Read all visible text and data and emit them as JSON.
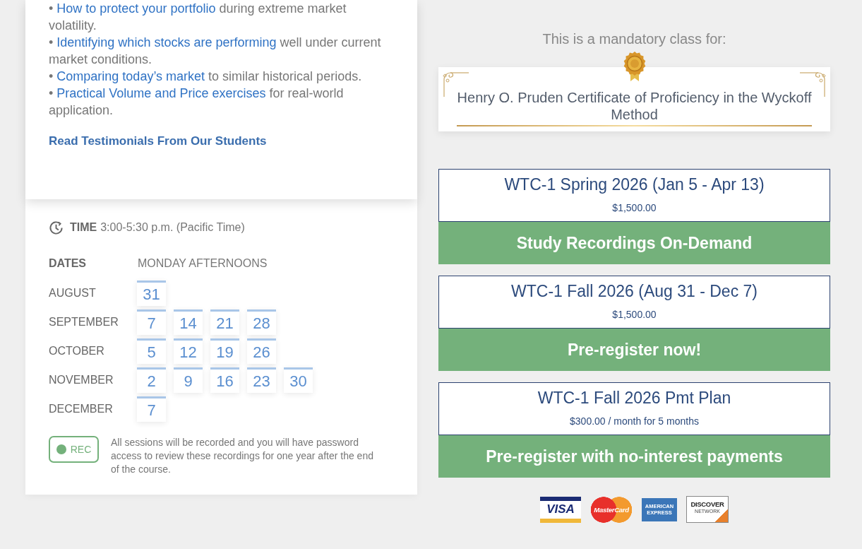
{
  "benefits": {
    "items": [
      {
        "bullet": "•",
        "link": "How to protect your portfolio",
        "text": "during extreme market volatility."
      },
      {
        "bullet": "•",
        "link": "Identifying which stocks are performing",
        "text": "well under current market conditions."
      },
      {
        "bullet": "•",
        "link": "Comparing today’s market",
        "text": "to similar historical periods."
      },
      {
        "bullet": "•",
        "link": "Practical Volume and Price exercises",
        "text": "for real-world application."
      }
    ],
    "testimonials_link": "Read Testimonials From Our Students"
  },
  "schedule": {
    "time_label": "TIME",
    "time": "3:00-5:30 p.m. (Pacific Time)",
    "dates_label": "DATES",
    "days_label": "MONDAY AFTERNOONS",
    "months": [
      {
        "name": "AUGUST",
        "dates": [
          "31"
        ]
      },
      {
        "name": "SEPTEMBER",
        "dates": [
          "7",
          "14",
          "21",
          "28"
        ]
      },
      {
        "name": "OCTOBER",
        "dates": [
          "5",
          "12",
          "19",
          "26"
        ]
      },
      {
        "name": "NOVEMBER",
        "dates": [
          "2",
          "9",
          "16",
          "23",
          "30"
        ]
      },
      {
        "name": "DECEMBER",
        "dates": [
          "7"
        ]
      }
    ]
  },
  "recording": {
    "badge": "REC",
    "note": "All sessions will be recorded and you will have password access to review these recordings for one year after the end of the course."
  },
  "certificate": {
    "intro": "This is a mandatory class for:",
    "title": "Henry O. Pruden Certificate of Proficiency in the Wyckoff Method"
  },
  "courses": [
    {
      "title": "WTC-1 Spring 2026 (Jan 5 - Apr 13)",
      "price": "$1,500.00",
      "button": "Study Recordings On-Demand"
    },
    {
      "title": "WTC-1 Fall 2026 (Aug 31 - Dec 7)",
      "price": "$1,500.00",
      "button": "Pre-register now!"
    },
    {
      "title": "WTC-1 Fall 2026 Pmt Plan",
      "price": "$300.00 / month for 5 months",
      "button": "Pre-register with no-interest payments"
    }
  ],
  "payment_logos": [
    {
      "kind": "visa",
      "text": "VISA"
    },
    {
      "kind": "mastercard",
      "text": "MasterCard"
    },
    {
      "kind": "amex",
      "text": "AMERICAN EXPRESS"
    },
    {
      "kind": "discover",
      "text": "DISCOVER",
      "subtext": "NETWORK"
    }
  ]
}
